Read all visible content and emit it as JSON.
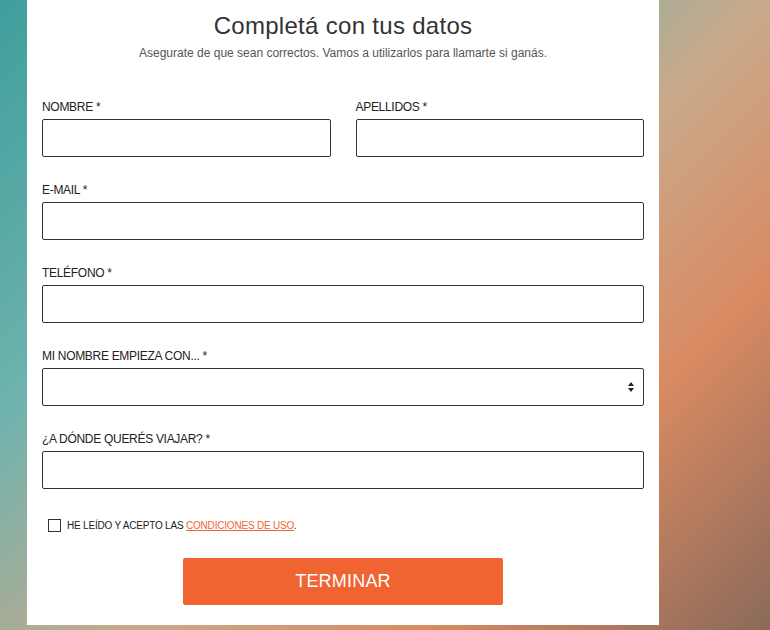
{
  "form": {
    "title": "Completá con tus datos",
    "subtitle": "Asegurate de que sean correctos. Vamos a utilizarlos para llamarte si ganás.",
    "rows": [
      [
        {
          "label": "NOMBRE *",
          "kind": "text",
          "value": ""
        },
        {
          "label": "APELLIDOS *",
          "kind": "text",
          "value": ""
        }
      ],
      [
        {
          "label": "E-MAIL *",
          "kind": "text",
          "value": ""
        }
      ],
      [
        {
          "label": "TELÉFONO *",
          "kind": "text",
          "value": ""
        }
      ],
      [
        {
          "label": "MI NOMBRE EMPIEZA CON... *",
          "kind": "select",
          "value": ""
        }
      ],
      [
        {
          "label": "¿A DÓNDE QUERÉS VIAJAR? *",
          "kind": "text",
          "value": ""
        }
      ]
    ],
    "terms": {
      "text": "HE LEÍDO Y ACEPTO LAS",
      "link": "CONDICIONES DE USO",
      "end": ".",
      "checked": false
    },
    "submit": "TERMINAR"
  }
}
